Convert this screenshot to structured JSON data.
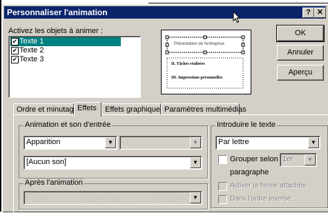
{
  "window": {
    "title": "Personnaliser l'animation",
    "help_button": "?",
    "close_button": "✕"
  },
  "objects": {
    "label": "Activez les objets à animer :",
    "items": [
      {
        "label": "Texte 1",
        "checked": true,
        "selected": true
      },
      {
        "label": "Texte 2",
        "checked": true,
        "selected": false
      },
      {
        "label": "Texte 3",
        "checked": true,
        "selected": false
      }
    ]
  },
  "preview": {
    "title": "Présentation de l'entreprise",
    "line2": "II. Tâches réalisées",
    "line3": "III. Impressions personnelles"
  },
  "buttons": {
    "ok": "OK",
    "cancel": "Annuler",
    "preview": "Aperçu"
  },
  "tabs": [
    {
      "label": "Ordre et minutage",
      "active": false
    },
    {
      "label": "Effets",
      "active": true
    },
    {
      "label": "Effets graphiques",
      "active": false
    },
    {
      "label": "Paramètres multimédias",
      "active": false
    }
  ],
  "effects": {
    "entry_group_label": "Animation et son d'entrée",
    "effect_value": "Apparition",
    "direction_value": "",
    "sound_value": "[Aucun son]",
    "after_group_label": "Après l'animation",
    "after_value": ""
  },
  "text_intro": {
    "group_label": "Introduire le texte",
    "mode_value": "Par lettre",
    "group_by_label": "Grouper selon le",
    "level_value": "1er",
    "paragraph_label": "paragraphe",
    "attached_shape_label": "Activer la forme attachée",
    "reverse_order_label": "Dans l'ordre inverse"
  },
  "colors": {
    "title_bar": "#0a246a",
    "selection": "#008080",
    "dialog_face": "#d4d0c8"
  }
}
